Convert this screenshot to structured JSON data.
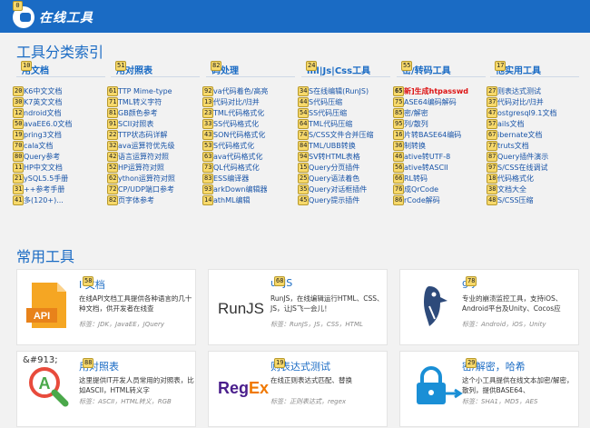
{
  "header": {
    "logo_text": "在线工具",
    "badge": "0"
  },
  "index_title": "工具分类索引",
  "common_title": "常用工具",
  "columns": [
    {
      "head": "用文档",
      "head_badge": "10",
      "items": [
        {
          "text": "K6中文文档",
          "badge": "20"
        },
        {
          "text": "K7英文文档",
          "badge": "30"
        },
        {
          "text": "ndroid文档",
          "badge": "12"
        },
        {
          "text": "avaEE6.0文档",
          "badge": "50"
        },
        {
          "text": "pring3文档",
          "badge": "19"
        },
        {
          "text": "cala文档",
          "badge": "70"
        },
        {
          "text": "Query参考",
          "badge": "80"
        },
        {
          "text": "HP中文文档",
          "badge": "11"
        },
        {
          "text": "ySQL5.5手册",
          "badge": "21"
        },
        {
          "text": "++参考手册",
          "badge": "31"
        },
        {
          "text": "多(120+)...",
          "badge": "41"
        }
      ]
    },
    {
      "head": "用对照表",
      "head_badge": "51",
      "items": [
        {
          "text": "TTP Mime-type",
          "badge": "61"
        },
        {
          "text": "TML转义字符",
          "badge": "71"
        },
        {
          "text": "GB颜色参考",
          "badge": "81"
        },
        {
          "text": "SCII对照表",
          "badge": "91"
        },
        {
          "text": "TTP状态码详解",
          "badge": "22"
        },
        {
          "text": "ava运算符优先级",
          "badge": "32"
        },
        {
          "text": "语言运算符对照",
          "badge": "42"
        },
        {
          "text": "HP运算符对照",
          "badge": "52"
        },
        {
          "text": "ython运算符对照",
          "badge": "62"
        },
        {
          "text": "CP/UDP端口参考",
          "badge": "72"
        },
        {
          "text": "页字体参考",
          "badge": "82"
        }
      ]
    },
    {
      "head": "码处理",
      "head_badge": "82",
      "items": [
        {
          "text": "va代码着色/高亮",
          "badge": "92"
        },
        {
          "text": "代码对比/归并",
          "badge": "13"
        },
        {
          "text": "TML代码格式化",
          "badge": "23"
        },
        {
          "text": "SS代码格式化",
          "badge": "33"
        },
        {
          "text": "SON代码格式化",
          "badge": "43"
        },
        {
          "text": "S代码格式化",
          "badge": "53"
        },
        {
          "text": "ava代码格式化",
          "badge": "63"
        },
        {
          "text": "QL代码格式化",
          "badge": "73"
        },
        {
          "text": "ESS编译器",
          "badge": "83"
        },
        {
          "text": "arkDown编辑器",
          "badge": "93"
        },
        {
          "text": "athML编辑",
          "badge": "14"
        }
      ]
    },
    {
      "head": "ml|Js|Css工具",
      "head_badge": "24",
      "items": [
        {
          "text": "S在线编辑(RunJS)",
          "badge": "34"
        },
        {
          "text": "S代码压缩",
          "badge": "44"
        },
        {
          "text": "SS代码压缩",
          "badge": "54"
        },
        {
          "text": "TML代码压缩",
          "badge": "64"
        },
        {
          "text": "S/CSS文件合并压缩",
          "badge": "74"
        },
        {
          "text": "TML/UBB转换",
          "badge": "84"
        },
        {
          "text": "SV转HTML表格",
          "badge": "94"
        },
        {
          "text": "Query分页插件",
          "badge": "15"
        },
        {
          "text": "Query语法着色",
          "badge": "25"
        },
        {
          "text": "Query对话框插件",
          "badge": "35"
        },
        {
          "text": "Query提示插件",
          "badge": "45"
        }
      ]
    },
    {
      "head": "密/转码工具",
      "head_badge": "55",
      "items": [
        {
          "text": "新]生成htpasswd",
          "badge": "65",
          "red": true
        },
        {
          "text": "ASE64编码解码",
          "badge": "75"
        },
        {
          "text": "密/解密",
          "badge": "85"
        },
        {
          "text": "列/散列",
          "badge": "95"
        },
        {
          "text": "片转BASE64编码",
          "badge": "16"
        },
        {
          "text": "制转换",
          "badge": "36"
        },
        {
          "text": "ative转UTF-8",
          "badge": "46"
        },
        {
          "text": "ative转ASCII",
          "badge": "56"
        },
        {
          "text": "RL转码",
          "badge": "66"
        },
        {
          "text": "成QrCode",
          "badge": "76"
        },
        {
          "text": "rCode解码",
          "badge": "86"
        }
      ]
    },
    {
      "head": "他实用工具",
      "head_badge": "17",
      "items": [
        {
          "text": "则表达式测试",
          "badge": "27"
        },
        {
          "text": "代码对比/归并",
          "badge": "37"
        },
        {
          "text": "ostgresql9.1文档",
          "badge": "47"
        },
        {
          "text": "ails文档",
          "badge": "57"
        },
        {
          "text": "ibernate文档",
          "badge": "67"
        },
        {
          "text": "truts文档",
          "badge": "77"
        },
        {
          "text": "Query插件演示",
          "badge": "87"
        },
        {
          "text": "S/CSS在线调试",
          "badge": "97"
        },
        {
          "text": "代码格式化",
          "badge": "18"
        },
        {
          "text": "文档大全",
          "badge": "38"
        },
        {
          "text": "S/CSS压缩",
          "badge": "48"
        }
      ]
    }
  ],
  "cards": [
    {
      "title": "I 文档",
      "badge": "58",
      "icon": "api-icon",
      "desc": "在线API文档工具提供各种语言的几十种文档，供开发者在线查",
      "tags": "标签：JDK，JavaEE，JQuery"
    },
    {
      "title": "unJS",
      "badge": "68",
      "icon": "runjs-icon",
      "icon_text": "RunJS",
      "desc": "RunJS，在线编辑运行HTML、CSS、JS，让JS飞一会儿！",
      "tags": "标签：RunJS，JS，CSS，HTML"
    },
    {
      "title": "gly",
      "badge": "78",
      "icon": "bugly-bird-icon",
      "desc": "专业的崩溃监控工具，支持iOS、Android平台及Unity、Cocos应",
      "tags": "标签：Android，iOS，Unity"
    },
    {
      "title": "用对照表",
      "badge": "88",
      "icon": "ascii-magnifier-icon",
      "icon_text": "&#913;",
      "desc": "这里提供IT开发人员常用的对照表，比如ASCII，HTML转义字",
      "tags": "标签：ASCII，HTML转义，RGB"
    },
    {
      "title": "则表达式测试",
      "badge": "19",
      "icon": "regex-icon",
      "icon_text_a": "Reg",
      "icon_text_b": "Ex",
      "desc": "在线正则表达式匹配、替换",
      "tags": "标签：正则表达式，regex"
    },
    {
      "title": "密/解密，哈希",
      "badge": "29",
      "icon": "lock-icon",
      "desc": "这个小工具提供在线文本加密/解密，散列，提供BASE64、",
      "tags": "标签：SHA1，MD5，AES"
    }
  ],
  "colors": {
    "brand": "#1a6bc4",
    "api_orange": "#f5a623",
    "regex_purple": "#4a1e8c",
    "regex_orange": "#f07800"
  }
}
